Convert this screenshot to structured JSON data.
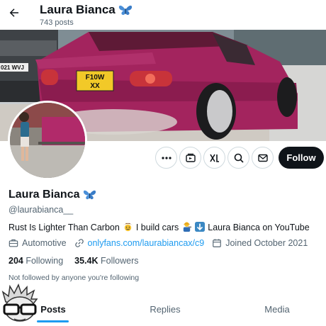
{
  "header": {
    "name": "Laura Bianca",
    "posts_count": "743 posts"
  },
  "banner": {
    "plate": "F10W XX",
    "plate_left": "021 WVJ"
  },
  "actions": {
    "follow_label": "Follow"
  },
  "profile": {
    "display_name": "Laura Bianca",
    "handle": "@laurabianca__",
    "bio_part1": "Rust Is Lighter Than Carbon",
    "bio_part2": "I build cars",
    "bio_part3": "Laura Bianca on YouTube",
    "category": "Automotive",
    "link": "onlyfans.com/laurabiancax/c9",
    "joined": "Joined October 2021",
    "following_count": "204",
    "following_label": "Following",
    "followers_count": "35.4K",
    "followers_label": "Followers",
    "not_followed": "Not followed by anyone you're following"
  },
  "tabs": [
    {
      "label": "Posts",
      "active": true
    },
    {
      "label": "Replies",
      "active": false
    },
    {
      "label": "Media",
      "active": false
    }
  ],
  "colors": {
    "accent": "#1d9bf0",
    "car": "#a3245e",
    "text": "#0f1419",
    "muted": "#536471"
  },
  "icons": {
    "back": "arrow-left-icon",
    "verified": "butterfly-icon",
    "more": "more-icon",
    "subscribe": "subscribe-icon",
    "grok": "grok-icon",
    "search": "search-icon",
    "message": "envelope-icon",
    "category": "briefcase-icon",
    "link": "link-icon",
    "calendar": "calendar-icon"
  }
}
